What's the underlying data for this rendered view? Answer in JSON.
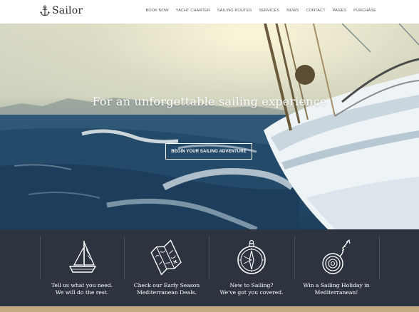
{
  "brand": {
    "name": "Sailor",
    "icon": "anchor-icon"
  },
  "nav": [
    {
      "label": "BOOK NOW"
    },
    {
      "label": "YACHT CHARTER"
    },
    {
      "label": "SAILING ROUTES"
    },
    {
      "label": "SERVICES"
    },
    {
      "label": "NEWS"
    },
    {
      "label": "CONTACT"
    },
    {
      "label": "PAGES"
    },
    {
      "label": "PURCHASE"
    }
  ],
  "hero": {
    "title": "For an unforgettable sailing experience",
    "button_label": "BEGIN YOUR SAILING ADVENTURE"
  },
  "features": [
    {
      "icon": "sailboat-icon",
      "line1": "Tell us what you need.",
      "line2": "We will do the rest."
    },
    {
      "icon": "map-icon",
      "line1": "Check our Early Season",
      "line2": "Mediterranean Deals."
    },
    {
      "icon": "compass-icon",
      "line1": "New to Sailing?",
      "line2": "We've got you covered."
    },
    {
      "icon": "rope-icon",
      "line1": "Win a Sailing Holiday in",
      "line2": "Mediterranean!"
    }
  ],
  "colors": {
    "band": "#2d3440",
    "strip": "#c3a97f"
  }
}
